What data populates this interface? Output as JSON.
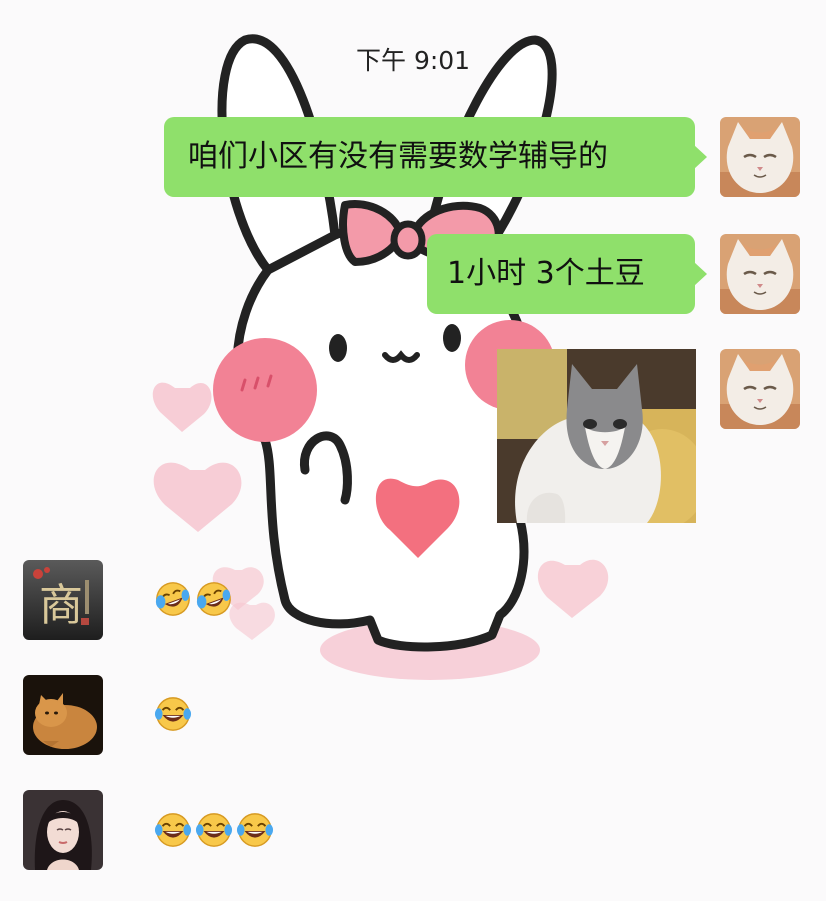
{
  "chat": {
    "timestamp": "下午 9:01",
    "messages_out": [
      {
        "text": "咱们小区有没有需要数学辅导的",
        "sender_avatar": "orange-white-cat-avatar"
      },
      {
        "text": "1小时 3个土豆",
        "sender_avatar": "orange-white-cat-avatar"
      },
      {
        "type": "image",
        "image": "gray-white-cat-photo",
        "sender_avatar": "orange-white-cat-avatar"
      }
    ],
    "messages_in": [
      {
        "avatar": "calligraphy-shang-avatar",
        "avatar_text": "商",
        "emojis": [
          "crying-laughing-emoji",
          "crying-laughing-emoji"
        ]
      },
      {
        "avatar": "orange-cat-avatar",
        "emojis": [
          "laughing-tears-emoji"
        ]
      },
      {
        "avatar": "girl-portrait-avatar",
        "emojis": [
          "laughing-tears-emoji",
          "laughing-tears-emoji",
          "laughing-tears-emoji"
        ]
      }
    ],
    "wallpaper": "cute-white-bunny-with-pink-bow-and-hearts",
    "colors": {
      "bubble_out": "#8fe06b",
      "background": "#fbfafb",
      "heart_pink": "#f6b6c3",
      "heart_red": "#f3707f",
      "emoji_yellow": "#f8c84a"
    }
  }
}
